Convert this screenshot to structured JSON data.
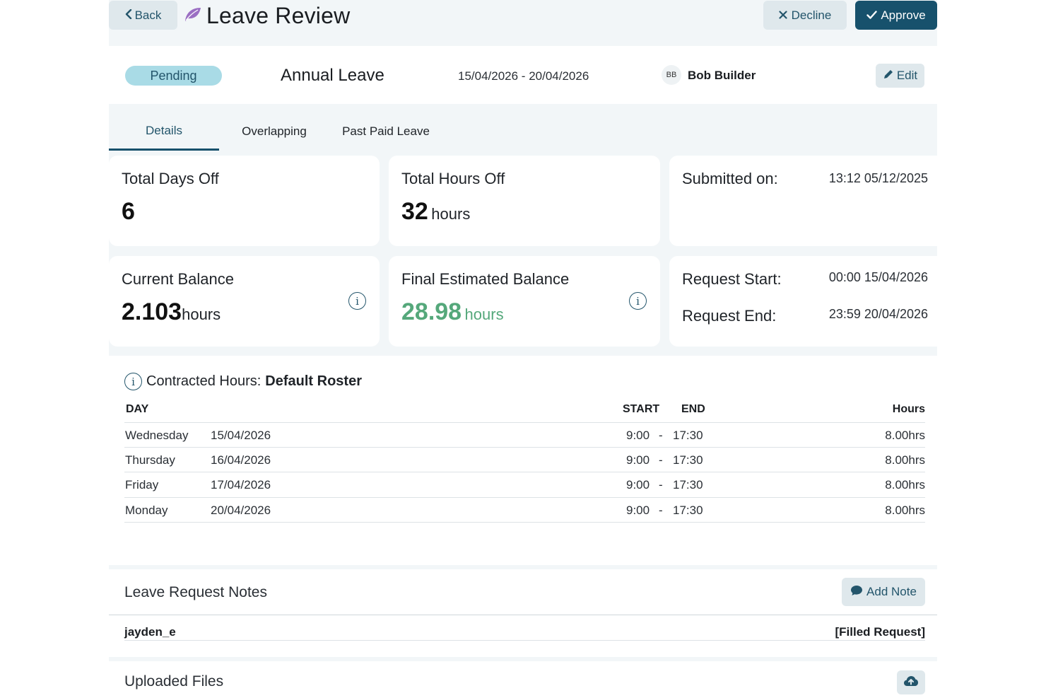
{
  "header": {
    "back_label": "Back",
    "title": "Leave Review",
    "decline_label": "Decline",
    "approve_label": "Approve"
  },
  "summary": {
    "status": "Pending",
    "leave_type": "Annual Leave",
    "date_range": "15/04/2026 - 20/04/2026",
    "avatar_initials": "BB",
    "employee_name": "Bob Builder",
    "edit_label": "Edit"
  },
  "tabs": [
    {
      "label": "Details",
      "active": true
    },
    {
      "label": "Overlapping",
      "active": false
    },
    {
      "label": "Past Paid Leave",
      "active": false
    }
  ],
  "stats": {
    "total_days_label": "Total Days Off",
    "total_days_value": "6",
    "total_hours_label": "Total Hours Off",
    "total_hours_value": "32",
    "total_hours_unit": "hours",
    "submitted_label": "Submitted on:",
    "submitted_value": "13:12 05/12/2025",
    "current_balance_label": "Current Balance",
    "current_balance_value": "2.103",
    "current_balance_unit": "hours",
    "final_balance_label": "Final Estimated Balance",
    "final_balance_value": "28.98",
    "final_balance_unit": "hours",
    "request_start_label": "Request Start:",
    "request_start_value": "00:00 15/04/2026",
    "request_end_label": "Request End:",
    "request_end_value": "23:59 20/04/2026"
  },
  "contracted": {
    "label": "Contracted Hours:",
    "roster": "Default Roster",
    "columns": {
      "day": "DAY",
      "start": "START",
      "end": "END",
      "hours": "Hours"
    },
    "separator": "-",
    "rows": [
      {
        "day": "Wednesday",
        "date": "15/04/2026",
        "start": "9:00",
        "end": "17:30",
        "hours": "8.00hrs"
      },
      {
        "day": "Thursday",
        "date": "16/04/2026",
        "start": "9:00",
        "end": "17:30",
        "hours": "8.00hrs"
      },
      {
        "day": "Friday",
        "date": "17/04/2026",
        "start": "9:00",
        "end": "17:30",
        "hours": "8.00hrs"
      },
      {
        "day": "Monday",
        "date": "20/04/2026",
        "start": "9:00",
        "end": "17:30",
        "hours": "8.00hrs"
      }
    ]
  },
  "notes": {
    "title": "Leave Request Notes",
    "add_label": "Add Note",
    "items": [
      {
        "author": "jayden_e",
        "text": "[Filled Request]"
      }
    ]
  },
  "uploads": {
    "title": "Uploaded Files"
  },
  "colors": {
    "primary": "#17516c",
    "pending_pill": "#a9dbe6",
    "positive": "#55a87b",
    "leaf_icon": "#9b6fc3"
  },
  "icons": [
    "chevron-left-icon",
    "leaf-icon",
    "close-icon",
    "check-icon",
    "pencil-icon",
    "info-icon",
    "comment-icon",
    "cloud-upload-icon"
  ]
}
